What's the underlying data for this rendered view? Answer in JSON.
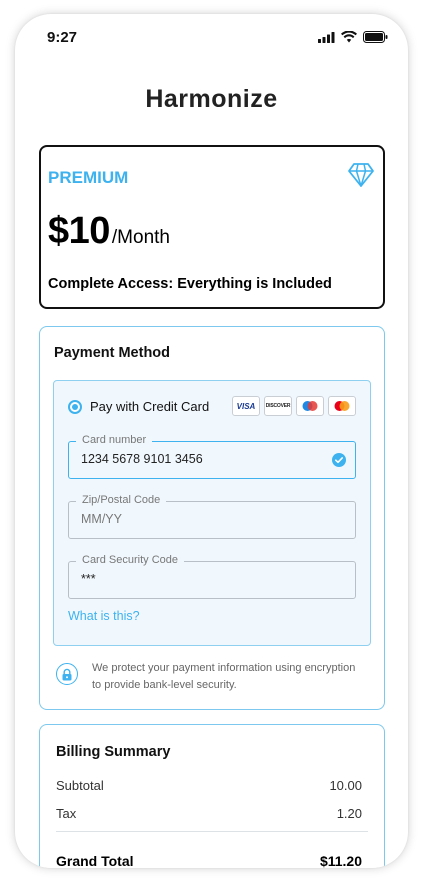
{
  "status_bar": {
    "time": "9:27"
  },
  "app": {
    "title": "Harmonize"
  },
  "plan": {
    "name": "PREMIUM",
    "price": "$10",
    "period": "/Month",
    "description": "Complete Access: Everything is Included"
  },
  "payment": {
    "heading": "Payment Method",
    "option_label": "Pay with Credit Card",
    "card_logos": [
      "VISA",
      "DISCOVER",
      "maestro",
      "mastercard"
    ],
    "fields": {
      "card_number": {
        "label": "Card number",
        "value": "1234 5678 9101 3456"
      },
      "zip": {
        "label": "Zip/Postal Code",
        "placeholder": "MM/YY"
      },
      "security_code": {
        "label": "Card Security Code",
        "value": "***"
      }
    },
    "help_link": "What is this?",
    "security_note": "We protect your payment information using encryption to provide bank-level security."
  },
  "billing": {
    "heading": "Billing Summary",
    "rows": [
      {
        "label": "Subtotal",
        "value": "10.00"
      },
      {
        "label": "Tax",
        "value": "1.20"
      }
    ],
    "total_label": "Grand Total",
    "total_value": "$11.20"
  },
  "colors": {
    "accent": "#3db2ef",
    "border_light": "#7cc8ee",
    "panel_bg": "#f1f8fd"
  },
  "icons": [
    "signal-icon",
    "wifi-icon",
    "battery-icon",
    "diamond-icon",
    "check-circle-icon",
    "lock-icon"
  ]
}
